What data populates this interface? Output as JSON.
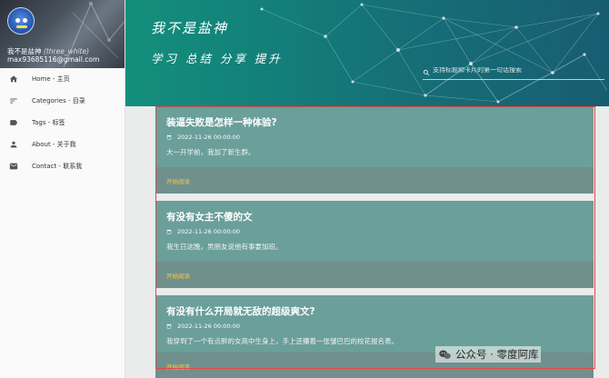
{
  "sidebar": {
    "user_name": "我不是盐神",
    "user_alias": "(three_white)",
    "email": "max93685116@gmail.com",
    "nav": [
      {
        "label": "Home - 主页",
        "icon": "home-icon"
      },
      {
        "label": "Categories - 目录",
        "icon": "categories-icon"
      },
      {
        "label": "Tags - 标签",
        "icon": "tag-icon"
      },
      {
        "label": "About - 关于我",
        "icon": "person-icon"
      },
      {
        "label": "Contact - 联系我",
        "icon": "mail-icon"
      }
    ]
  },
  "header": {
    "title": "我不是盐神",
    "slogan": "学习  总结  分享  提升",
    "search_placeholder": "支持标题和卡片的第一句话搜索"
  },
  "posts": [
    {
      "title": "装逼失败是怎样一种体验?",
      "date": "2022-11-26 00:00:00",
      "excerpt": "大一开学前，我加了新生群。",
      "read_more": "开始阅读"
    },
    {
      "title": "有没有女主不傻的文",
      "date": "2022-11-26 00:00:00",
      "excerpt": "我生日这晚，男朋友说他有事要加班。",
      "read_more": "开始阅读"
    },
    {
      "title": "有没有什么开局就无敌的超级爽文?",
      "date": "2022-11-26 00:00:00",
      "excerpt": "我穿到了一个有点胖的女高中生身上，手上还攥着一张皱巴巴的校花报名表。",
      "read_more": "开始阅读"
    }
  ],
  "watermark": "公众号 · 零度阿库",
  "colors": {
    "header": "#137f7a",
    "card": "#6a9f9a",
    "card_footer": "#6f908d",
    "read_more": "#f4c84a",
    "highlight_box": "#e64545"
  }
}
